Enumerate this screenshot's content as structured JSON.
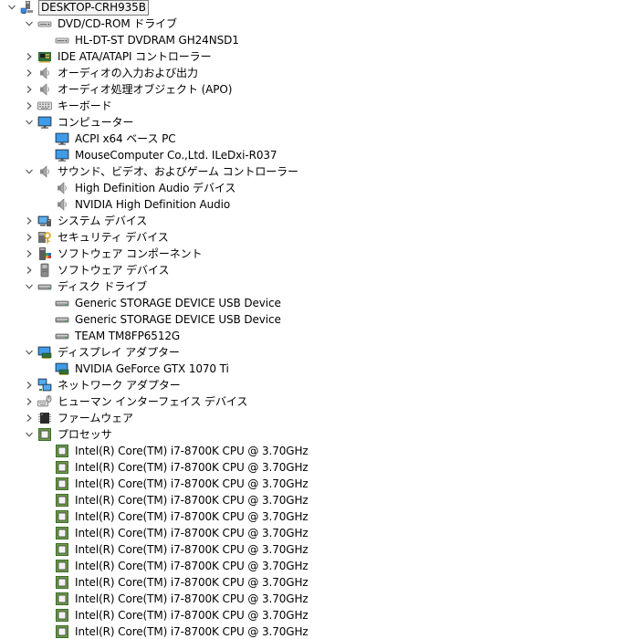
{
  "tree": {
    "nodes": [
      {
        "level": 0,
        "state": "expanded",
        "icon": "computer-root-icon",
        "label": "DESKTOP-CRH935B"
      },
      {
        "level": 1,
        "state": "expanded",
        "icon": "dvd-drive-icon",
        "label": "DVD/CD-ROM ドライブ"
      },
      {
        "level": 2,
        "state": "leaf",
        "icon": "dvd-drive-icon",
        "label": "HL-DT-ST DVDRAM GH24NSD1"
      },
      {
        "level": 1,
        "state": "collapsed",
        "icon": "ide-controller-icon",
        "label": "IDE ATA/ATAPI コントローラー"
      },
      {
        "level": 1,
        "state": "collapsed",
        "icon": "speaker-icon",
        "label": "オーディオの入力および出力"
      },
      {
        "level": 1,
        "state": "collapsed",
        "icon": "speaker-icon",
        "label": "オーディオ処理オブジェクト (APO)"
      },
      {
        "level": 1,
        "state": "collapsed",
        "icon": "keyboard-icon",
        "label": "キーボード"
      },
      {
        "level": 1,
        "state": "expanded",
        "icon": "monitor-icon",
        "label": "コンピューター"
      },
      {
        "level": 2,
        "state": "leaf",
        "icon": "monitor-icon",
        "label": "ACPI x64 ベース PC"
      },
      {
        "level": 2,
        "state": "leaf",
        "icon": "monitor-icon",
        "label": "MouseComputer Co.,Ltd. ILeDxi-R037"
      },
      {
        "level": 1,
        "state": "expanded",
        "icon": "speaker-icon",
        "label": "サウンド、ビデオ、およびゲーム コントローラー"
      },
      {
        "level": 2,
        "state": "leaf",
        "icon": "speaker-icon",
        "label": "High Definition Audio デバイス"
      },
      {
        "level": 2,
        "state": "leaf",
        "icon": "speaker-icon",
        "label": "NVIDIA High Definition Audio"
      },
      {
        "level": 1,
        "state": "collapsed",
        "icon": "system-device-icon",
        "label": "システム デバイス"
      },
      {
        "level": 1,
        "state": "collapsed",
        "icon": "security-device-icon",
        "label": "セキュリティ デバイス"
      },
      {
        "level": 1,
        "state": "collapsed",
        "icon": "software-component-icon",
        "label": "ソフトウェア コンポーネント"
      },
      {
        "level": 1,
        "state": "collapsed",
        "icon": "software-device-icon",
        "label": "ソフトウェア デバイス"
      },
      {
        "level": 1,
        "state": "expanded",
        "icon": "disk-drive-icon",
        "label": "ディスク ドライブ"
      },
      {
        "level": 2,
        "state": "leaf",
        "icon": "disk-drive-icon",
        "label": "Generic STORAGE DEVICE USB Device"
      },
      {
        "level": 2,
        "state": "leaf",
        "icon": "disk-drive-icon",
        "label": "Generic STORAGE DEVICE USB Device"
      },
      {
        "level": 2,
        "state": "leaf",
        "icon": "disk-drive-icon",
        "label": "TEAM TM8FP6512G"
      },
      {
        "level": 1,
        "state": "expanded",
        "icon": "display-adapter-icon",
        "label": "ディスプレイ アダプター"
      },
      {
        "level": 2,
        "state": "leaf",
        "icon": "display-adapter-icon",
        "label": "NVIDIA GeForce GTX 1070 Ti"
      },
      {
        "level": 1,
        "state": "collapsed",
        "icon": "network-adapter-icon",
        "label": "ネットワーク アダプター"
      },
      {
        "level": 1,
        "state": "collapsed",
        "icon": "hid-icon",
        "label": "ヒューマン インターフェイス デバイス"
      },
      {
        "level": 1,
        "state": "collapsed",
        "icon": "firmware-icon",
        "label": "ファームウェア"
      },
      {
        "level": 1,
        "state": "expanded",
        "icon": "processor-icon",
        "label": "プロセッサ"
      },
      {
        "level": 2,
        "state": "leaf",
        "icon": "processor-icon",
        "label": "Intel(R) Core(TM) i7-8700K CPU @ 3.70GHz"
      },
      {
        "level": 2,
        "state": "leaf",
        "icon": "processor-icon",
        "label": "Intel(R) Core(TM) i7-8700K CPU @ 3.70GHz"
      },
      {
        "level": 2,
        "state": "leaf",
        "icon": "processor-icon",
        "label": "Intel(R) Core(TM) i7-8700K CPU @ 3.70GHz"
      },
      {
        "level": 2,
        "state": "leaf",
        "icon": "processor-icon",
        "label": "Intel(R) Core(TM) i7-8700K CPU @ 3.70GHz"
      },
      {
        "level": 2,
        "state": "leaf",
        "icon": "processor-icon",
        "label": "Intel(R) Core(TM) i7-8700K CPU @ 3.70GHz"
      },
      {
        "level": 2,
        "state": "leaf",
        "icon": "processor-icon",
        "label": "Intel(R) Core(TM) i7-8700K CPU @ 3.70GHz"
      },
      {
        "level": 2,
        "state": "leaf",
        "icon": "processor-icon",
        "label": "Intel(R) Core(TM) i7-8700K CPU @ 3.70GHz"
      },
      {
        "level": 2,
        "state": "leaf",
        "icon": "processor-icon",
        "label": "Intel(R) Core(TM) i7-8700K CPU @ 3.70GHz"
      },
      {
        "level": 2,
        "state": "leaf",
        "icon": "processor-icon",
        "label": "Intel(R) Core(TM) i7-8700K CPU @ 3.70GHz"
      },
      {
        "level": 2,
        "state": "leaf",
        "icon": "processor-icon",
        "label": "Intel(R) Core(TM) i7-8700K CPU @ 3.70GHz"
      },
      {
        "level": 2,
        "state": "leaf",
        "icon": "processor-icon",
        "label": "Intel(R) Core(TM) i7-8700K CPU @ 3.70GHz"
      },
      {
        "level": 2,
        "state": "leaf",
        "icon": "processor-icon",
        "label": "Intel(R) Core(TM) i7-8700K CPU @ 3.70GHz"
      }
    ]
  }
}
